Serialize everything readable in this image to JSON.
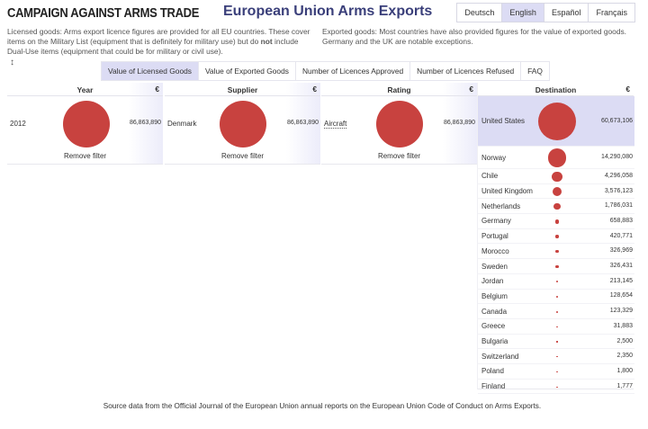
{
  "header": {
    "logo": "CAMPAIGN AGAINST ARMS TRADE",
    "title": "European Union Arms Exports",
    "languages": [
      "Deutsch",
      "English",
      "Español",
      "Français"
    ],
    "active_language": "English"
  },
  "descriptions": {
    "left_prefix": "Licensed goods: Arms export licence figures are provided for all EU countries. These cover items on the Military List (equipment that is definitely for military use) but do ",
    "left_bold": "not",
    "left_suffix": " include Dual-Use items (equipment that could be for military or civil use).",
    "right": "Exported goods: Most countries have also provided figures for the value of exported goods. Germany and the UK are notable exceptions."
  },
  "sort_handle": "↕",
  "tabs": [
    {
      "label": "Value of Licensed Goods",
      "active": true
    },
    {
      "label": "Value of Exported Goods",
      "active": false
    },
    {
      "label": "Number of Licences Approved",
      "active": false
    },
    {
      "label": "Number of Licences Refused",
      "active": false
    },
    {
      "label": "FAQ",
      "active": false
    }
  ],
  "panels": {
    "currency_symbol": "€",
    "remove_label": "Remove filter",
    "bubble_color": "#c8423f",
    "year": {
      "title": "Year",
      "label": "2012",
      "value": "86,863,890"
    },
    "supplier": {
      "title": "Supplier",
      "label": "Denmark",
      "value": "86,863,890"
    },
    "rating": {
      "title": "Rating",
      "label": "Aircraft",
      "value": "86,863,890"
    }
  },
  "destination": {
    "title": "Destination",
    "selected": "United States",
    "rows": [
      {
        "name": "United States",
        "value": "60,673,106",
        "amount": 60673106
      },
      {
        "name": "Norway",
        "value": "14,290,080",
        "amount": 14290080
      },
      {
        "name": "Chile",
        "value": "4,296,058",
        "amount": 4296058
      },
      {
        "name": "United Kingdom",
        "value": "3,576,123",
        "amount": 3576123
      },
      {
        "name": "Netherlands",
        "value": "1,786,031",
        "amount": 1786031
      },
      {
        "name": "Germany",
        "value": "658,883",
        "amount": 658883
      },
      {
        "name": "Portugal",
        "value": "420,771",
        "amount": 420771
      },
      {
        "name": "Morocco",
        "value": "326,969",
        "amount": 326969
      },
      {
        "name": "Sweden",
        "value": "326,431",
        "amount": 326431
      },
      {
        "name": "Jordan",
        "value": "213,145",
        "amount": 213145
      },
      {
        "name": "Belgium",
        "value": "128,654",
        "amount": 128654
      },
      {
        "name": "Canada",
        "value": "123,329",
        "amount": 123329
      },
      {
        "name": "Greece",
        "value": "31,883",
        "amount": 31883
      },
      {
        "name": "Bulgaria",
        "value": "2,500",
        "amount": 2500
      },
      {
        "name": "Switzerland",
        "value": "2,350",
        "amount": 2350
      },
      {
        "name": "Poland",
        "value": "1,800",
        "amount": 1800
      },
      {
        "name": "Finland",
        "value": "1,777",
        "amount": 1777
      }
    ]
  },
  "footer": "Source data from the Official Journal of the European Union annual reports on the European Union Code of Conduct on Arms Exports."
}
